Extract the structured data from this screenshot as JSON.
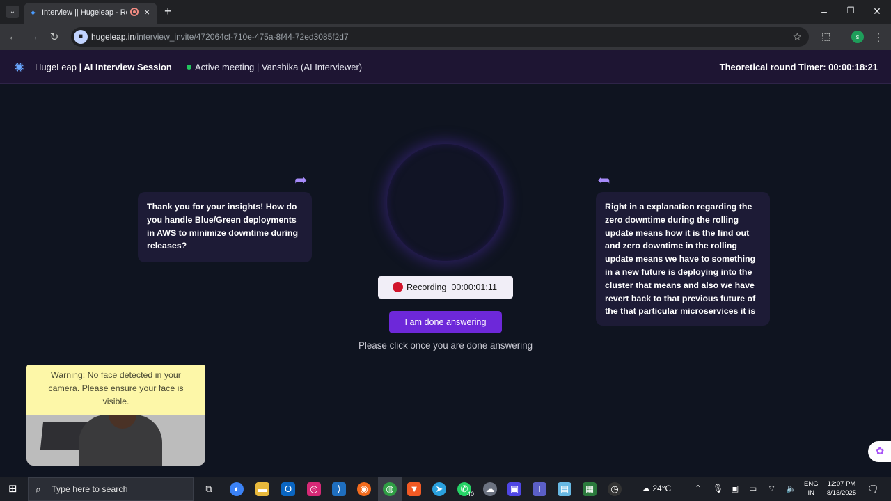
{
  "browser": {
    "tab_title": "Interview || Hugeleap - Revi",
    "url_host": "hugeleap.in",
    "url_path": "/interview_invite/472064cf-710e-475a-8f44-72ed3085f2d7"
  },
  "header": {
    "brand_name": "HugeLeap",
    "session_label": "| AI Interview Session",
    "meeting_status": "Active meeting | Vanshika (AI Interviewer)",
    "timer": "Theoretical round Timer: 00:00:18:21"
  },
  "conversation": {
    "interviewer_message": "Thank you for your insights! How do you handle Blue/Green deployments in AWS to minimize downtime during releases?",
    "candidate_message": "Right in a explanation regarding the zero downtime during the rolling update means how it is the find out and zero downtime in the rolling update means we have to something in a new future is deploying into the cluster that means and also we have revert back to that previous future of the that particular microservices it is"
  },
  "recording": {
    "label": "Recording",
    "elapsed": "00:00:01:11"
  },
  "actions": {
    "done_label": "I am done answering",
    "hint": "Please click once you are done answering"
  },
  "camera": {
    "warning": "Warning: No face detected in your camera. Please ensure your face is visible."
  },
  "taskbar": {
    "search_placeholder": "Type here to search",
    "whatsapp_badge": "40",
    "weather": "24°C",
    "lang_line1": "ENG",
    "lang_line2": "IN",
    "time": "12:07 PM",
    "date": "8/13/2025",
    "notification_count": "3"
  },
  "colors": {
    "accent": "#6d28d9",
    "header_bg": "#1e1533",
    "stage_bg": "#0f1420",
    "recording_dot": "#d1142b",
    "warning_bg": "#fdf7a8"
  }
}
